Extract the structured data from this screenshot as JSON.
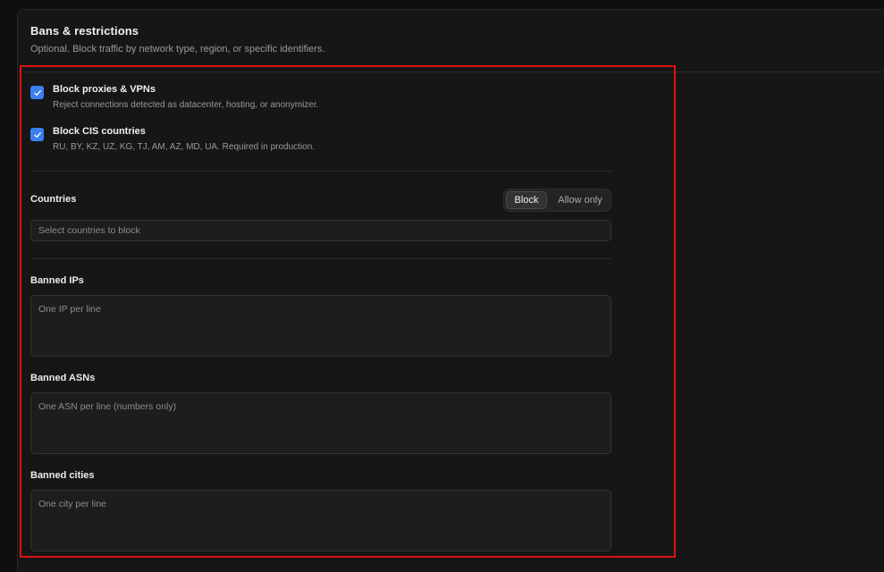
{
  "header": {
    "title": "Bans & restrictions",
    "subtitle": "Optional. Block traffic by network type, region, or specific identifiers."
  },
  "checkboxes": [
    {
      "label": "Block proxies & VPNs",
      "description": "Reject connections detected as datacenter, hosting, or anonymizer.",
      "checked": true
    },
    {
      "label": "Block CIS countries",
      "description": "RU, BY, KZ, UZ, KG, TJ, AM, AZ, MD, UA. Required in production.",
      "checked": true
    }
  ],
  "countries": {
    "label": "Countries",
    "mode_options": [
      "Block",
      "Allow only"
    ],
    "selected_mode": "Block",
    "select_placeholder": "Select countries to block"
  },
  "banned_ips": {
    "label": "Banned IPs",
    "placeholder": "One IP per line"
  },
  "banned_asns": {
    "label": "Banned ASNs",
    "placeholder": "One ASN per line (numbers only)"
  },
  "banned_cities": {
    "label": "Banned cities",
    "placeholder": "One city per line"
  },
  "colors": {
    "accent": "#3b7ff2",
    "highlight": "#e01010",
    "panel_bg": "#161616"
  }
}
